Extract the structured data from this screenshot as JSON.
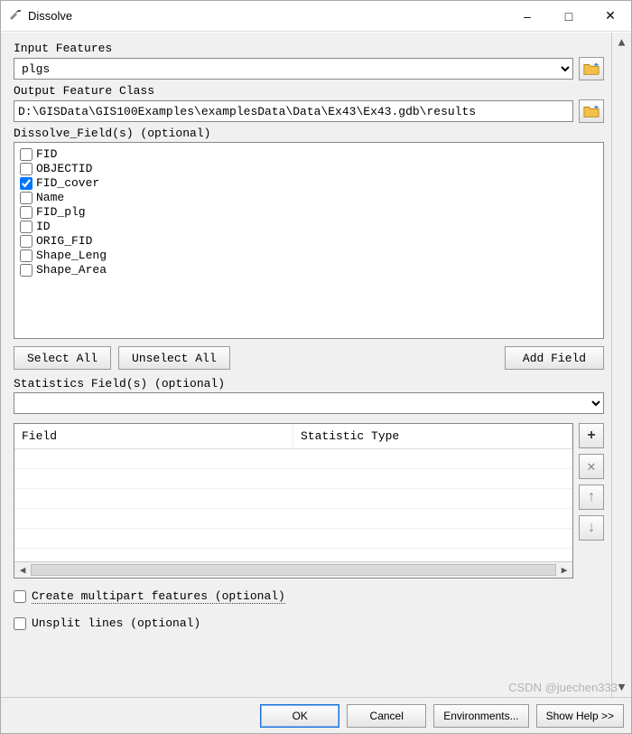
{
  "window": {
    "title": "Dissolve"
  },
  "labels": {
    "input_features": "Input Features",
    "output_feature_class": "Output Feature Class",
    "dissolve_fields": "Dissolve_Field(s) (optional)",
    "statistics_fields": "Statistics Field(s) (optional)",
    "field_col": "Field",
    "stat_type_col": "Statistic Type",
    "create_multipart": "Create multipart features (optional)",
    "unsplit_lines": "Unsplit lines (optional)"
  },
  "inputs": {
    "input_features_value": "plgs",
    "output_path": "D:\\GISData\\GIS100Examples\\examplesData\\Data\\Ex43\\Ex43.gdb\\results",
    "statistics_field_value": ""
  },
  "fields": [
    {
      "name": "FID",
      "checked": false
    },
    {
      "name": "OBJECTID",
      "checked": false
    },
    {
      "name": "FID_cover",
      "checked": true
    },
    {
      "name": "Name",
      "checked": false
    },
    {
      "name": "FID_plg",
      "checked": false
    },
    {
      "name": "ID",
      "checked": false
    },
    {
      "name": "ORIG_FID",
      "checked": false
    },
    {
      "name": "Shape_Leng",
      "checked": false
    },
    {
      "name": "Shape_Area",
      "checked": false
    }
  ],
  "buttons": {
    "select_all": "Select All",
    "unselect_all": "Unselect All",
    "add_field": "Add Field",
    "ok": "OK",
    "cancel": "Cancel",
    "environments": "Environments...",
    "show_help": "Show Help >>"
  },
  "options": {
    "create_multipart_checked": false,
    "unsplit_lines_checked": false
  },
  "watermark": "CSDN @juechen333"
}
